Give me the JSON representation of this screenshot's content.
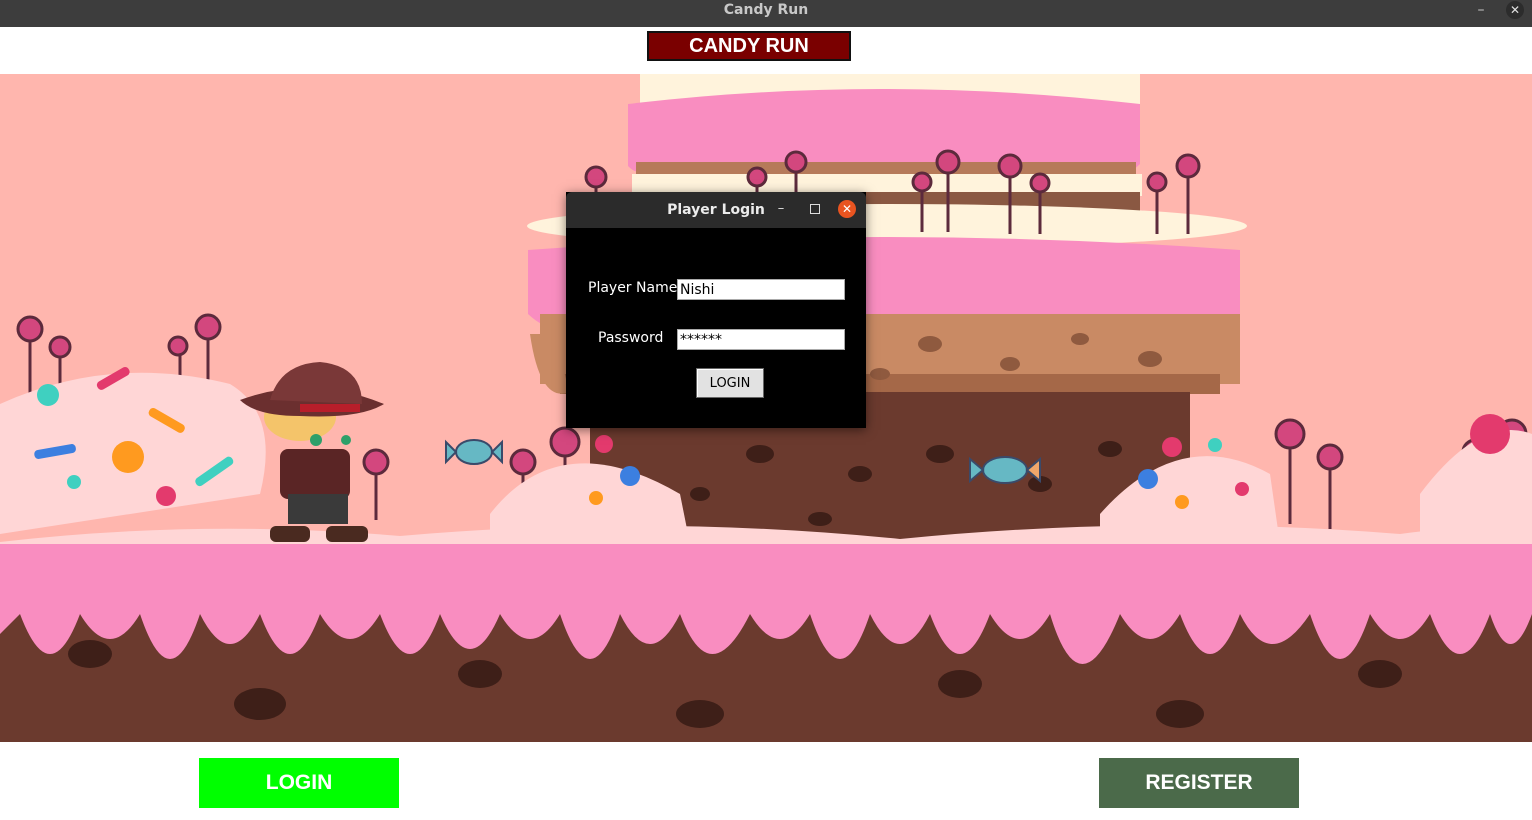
{
  "window": {
    "title": "Candy Run",
    "minimize_glyph": "–",
    "close_glyph": "✕"
  },
  "header": {
    "game_title": "CANDY RUN"
  },
  "colors": {
    "title_bg": "#7a0000",
    "login_button": "#00ff00",
    "register_button": "#4b6a4a",
    "scene_sky": "#ffb6ae",
    "icing_pink": "#f98dc0",
    "chocolate": "#6b3a2e"
  },
  "dialog": {
    "title": "Player Login",
    "minimize_glyph": "–",
    "close_glyph": "✕",
    "player_name_label": "Player Name",
    "player_name_value": "Nishi",
    "password_label": "Password",
    "password_value": "******",
    "login_button": "LOGIN"
  },
  "footer": {
    "login_button": "LOGIN",
    "register_button": "REGISTER"
  }
}
